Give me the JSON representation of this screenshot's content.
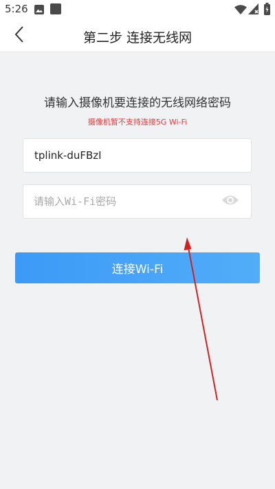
{
  "status_bar": {
    "time": "5:26",
    "icons": [
      "image-icon",
      "app-square-icon",
      "wifi-icon",
      "signal-icon",
      "battery-icon"
    ]
  },
  "header": {
    "back_icon": "chevron-left-icon",
    "title": "第二步 连接无线网"
  },
  "main": {
    "prompt": "请输入摄像机要连接的无线网络密码",
    "warning": "摄像机暂不支持连接5G Wi-Fi",
    "ssid_value": "tplink-duFBzI",
    "password": {
      "value": "",
      "placeholder": "请输入Wi-Fi密码",
      "toggle_icon": "eye-icon"
    },
    "connect_button": "连接Wi-Fi"
  },
  "colors": {
    "accent": "#3c9af7",
    "warning": "#e03c3c",
    "background": "#f1f2f4",
    "annotation_arrow": "#d51f1f"
  }
}
